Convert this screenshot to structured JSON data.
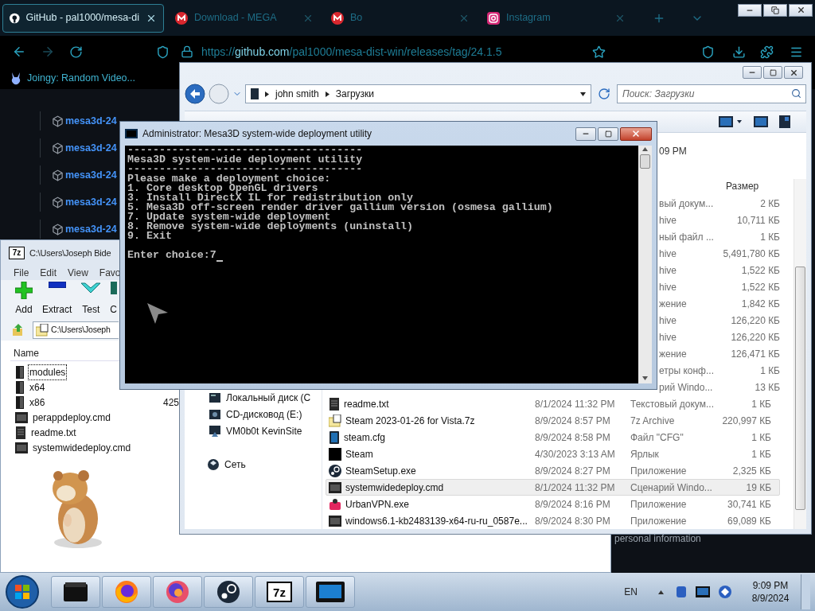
{
  "browser": {
    "tabs": [
      {
        "title": "GitHub - pal1000/mesa-di",
        "selected": true,
        "kind": "github"
      },
      {
        "title": "Download - MEGA",
        "selected": false,
        "kind": "mega"
      },
      {
        "title": "Bo",
        "selected": false,
        "kind": "mega"
      },
      {
        "title": "Instagram",
        "selected": false,
        "kind": "instagram"
      }
    ],
    "url": {
      "scheme": "https://",
      "host": "github.com",
      "path": "/pal1000/mesa-dist-win/releases/tag/24.1.5"
    },
    "bookmarks": [
      "Joingy: Random Video..."
    ],
    "releases": [
      "mesa3d-24",
      "mesa3d-24",
      "mesa3d-24",
      "mesa3d-24",
      "mesa3d-24"
    ],
    "footer": "personal information"
  },
  "explorer": {
    "breadcrumb": [
      "john smith",
      "Загрузки"
    ],
    "search": {
      "placeholder": "Поиск: Загрузки"
    },
    "modified_fragment": "09 PM",
    "size_header": "Размер",
    "nav": [
      {
        "label": "Локальный диск (C",
        "kind": "drive"
      },
      {
        "label": "CD-дисковод (E:)",
        "kind": "cd"
      },
      {
        "label": "VM0b0t KevinSite",
        "kind": "share"
      },
      {
        "label": "Сеть",
        "kind": "network"
      }
    ],
    "partial_rows": [
      {
        "type": "вый докум...",
        "size": "2 КБ"
      },
      {
        "type": "hive",
        "size": "10,711 КБ"
      },
      {
        "type": "ный файл ...",
        "size": "1 КБ"
      },
      {
        "type": "hive",
        "size": "5,491,780 КБ"
      },
      {
        "type": "hive",
        "size": "1,522 КБ"
      },
      {
        "type": "hive",
        "size": "1,522 КБ"
      },
      {
        "type": "жение",
        "size": "1,842 КБ"
      },
      {
        "type": "hive",
        "size": "126,220 КБ"
      },
      {
        "type": "hive",
        "size": "126,220 КБ"
      },
      {
        "type": "жение",
        "size": "126,471 КБ"
      },
      {
        "type": "етры конф...",
        "size": "1 КБ"
      },
      {
        "type": "рий Windo...",
        "size": "13 КБ"
      }
    ],
    "rows": [
      {
        "name": "readme.txt",
        "date": "8/1/2024 11:32 PM",
        "type": "Текстовый докум...",
        "size": "1 КБ",
        "kind": "text",
        "selected": false
      },
      {
        "name": "Steam 2023-01-26 for Vista.7z",
        "date": "8/9/2024 8:57 PM",
        "type": "7z Archive",
        "size": "220,997 КБ",
        "kind": "archive",
        "selected": false
      },
      {
        "name": "steam.cfg",
        "date": "8/9/2024 8:58 PM",
        "type": "Файл \"CFG\"",
        "size": "1 КБ",
        "kind": "config",
        "selected": false
      },
      {
        "name": "Steam",
        "date": "4/30/2023 3:13 AM",
        "type": "Ярлык",
        "size": "1 КБ",
        "kind": "shortcut",
        "selected": false
      },
      {
        "name": "SteamSetup.exe",
        "date": "8/9/2024 8:27 PM",
        "type": "Приложение",
        "size": "2,325 КБ",
        "kind": "steam",
        "selected": false
      },
      {
        "name": "systemwidedeploy.cmd",
        "date": "8/1/2024 11:32 PM",
        "type": "Сценарий Windo...",
        "size": "19 КБ",
        "kind": "script",
        "selected": true
      },
      {
        "name": "UrbanVPN.exe",
        "date": "8/9/2024 8:16 PM",
        "type": "Приложение",
        "size": "30,741 КБ",
        "kind": "vpn",
        "selected": false
      },
      {
        "name": "windows6.1-kb2483139-x64-ru-ru_0587e...",
        "date": "8/9/2024 8:30 PM",
        "type": "Приложение",
        "size": "69,089 КБ",
        "kind": "script",
        "selected": false
      }
    ]
  },
  "archiver": {
    "logo": "7z",
    "title": "C:\\Users\\Joseph Bide",
    "menu": [
      "File",
      "Edit",
      "View",
      "Favo"
    ],
    "tools": [
      {
        "label": "Add",
        "kind": "add"
      },
      {
        "label": "Extract",
        "kind": "extract"
      },
      {
        "label": "Test",
        "kind": "test"
      },
      {
        "label": "C",
        "kind": "copy"
      }
    ],
    "path": "C:\\Users\\Joseph",
    "name_header": "Name",
    "items": [
      {
        "name": "modules",
        "kind": "folder",
        "selected": true
      },
      {
        "name": "x64",
        "kind": "folder",
        "selected": false
      },
      {
        "name": "x86",
        "kind": "folder",
        "selected": false,
        "size": "425"
      },
      {
        "name": "perappdeploy.cmd",
        "kind": "script",
        "selected": false
      },
      {
        "name": "readme.txt",
        "kind": "text",
        "selected": false
      },
      {
        "name": "systemwidedeploy.cmd",
        "kind": "script",
        "selected": false
      }
    ]
  },
  "console": {
    "title": "Administrator:  Mesa3D system-wide deployment utility",
    "lines": [
      "-------------------------------------",
      "Mesa3D system-wide deployment utility",
      "-------------------------------------",
      "Please make a deployment choice:",
      "1. Core desktop OpenGL drivers",
      "3. Install DirectX IL for redistribution only",
      "5. Mesa3D off-screen render driver gallium version (osmesa gallium)",
      "7. Update system-wide deployment",
      "8. Remove system-wide deployments (uninstall)",
      "9. Exit"
    ],
    "prompt": "Enter choice:7",
    "caret": true
  },
  "taskbar": {
    "apps": [
      {
        "kind": "terminal"
      },
      {
        "kind": "firefox"
      },
      {
        "kind": "swirl"
      },
      {
        "kind": "steam"
      },
      {
        "kind": "archiver",
        "label": "7z"
      },
      {
        "kind": "monitor"
      }
    ],
    "language": "EN",
    "time": "9:09 PM",
    "date": "8/9/2024"
  }
}
